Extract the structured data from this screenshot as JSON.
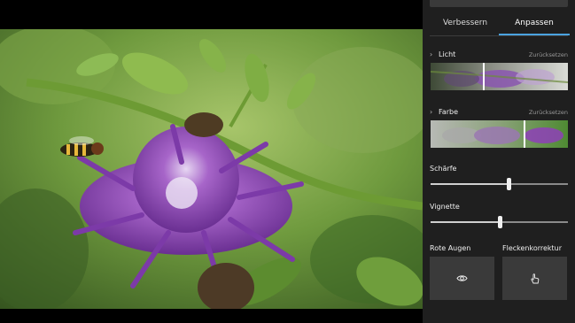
{
  "tabs": {
    "enhance": "Verbessern",
    "adjust": "Anpassen"
  },
  "light": {
    "title": "Licht",
    "reset": "Zurücksetzen",
    "level": 0.38
  },
  "color": {
    "title": "Farbe",
    "reset": "Zurücksetzen",
    "level": 0.68
  },
  "sharpness": {
    "label": "Schärfe",
    "value": 0.57
  },
  "vignette": {
    "label": "Vignette",
    "value": 0.5
  },
  "tools": {
    "red_eye": {
      "label": "Rote Augen",
      "icon": "eye-icon"
    },
    "spot_fix": {
      "label": "Fleckenkorrektur",
      "icon": "touch-hand-icon"
    }
  },
  "colors": {
    "accent": "#4aa3e0",
    "panel_bg": "#1f1f1f",
    "button_bg": "#3a3a3a"
  }
}
